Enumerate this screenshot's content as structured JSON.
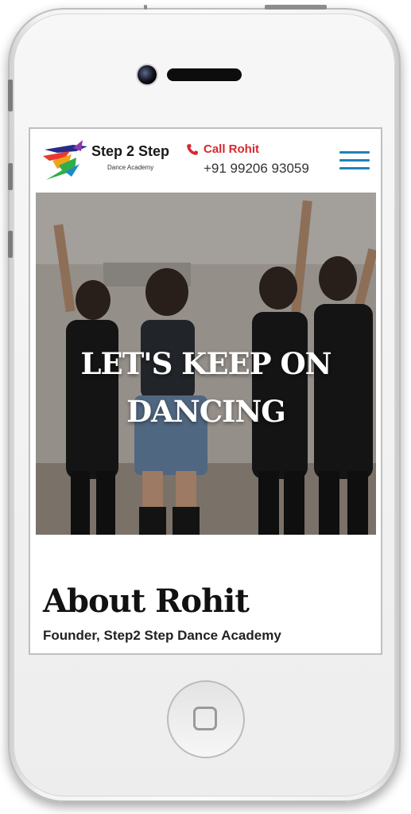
{
  "header": {
    "brand_name": "Step 2 Step",
    "brand_tagline": "Dance Academy",
    "call_label": "Call Rohit",
    "phone_number": "+91 99206 93059",
    "accent_color": "#d8282f",
    "menu_color": "#1f83b8"
  },
  "hero": {
    "title_line1": "LET'S KEEP ON",
    "title_line2": "DANCING"
  },
  "about": {
    "title": "About Rohit",
    "subtitle": "Founder, Step2 Step Dance Academy"
  },
  "icons": {
    "phone": "phone-icon",
    "menu": "hamburger-menu-icon",
    "home": "home-button-icon"
  }
}
